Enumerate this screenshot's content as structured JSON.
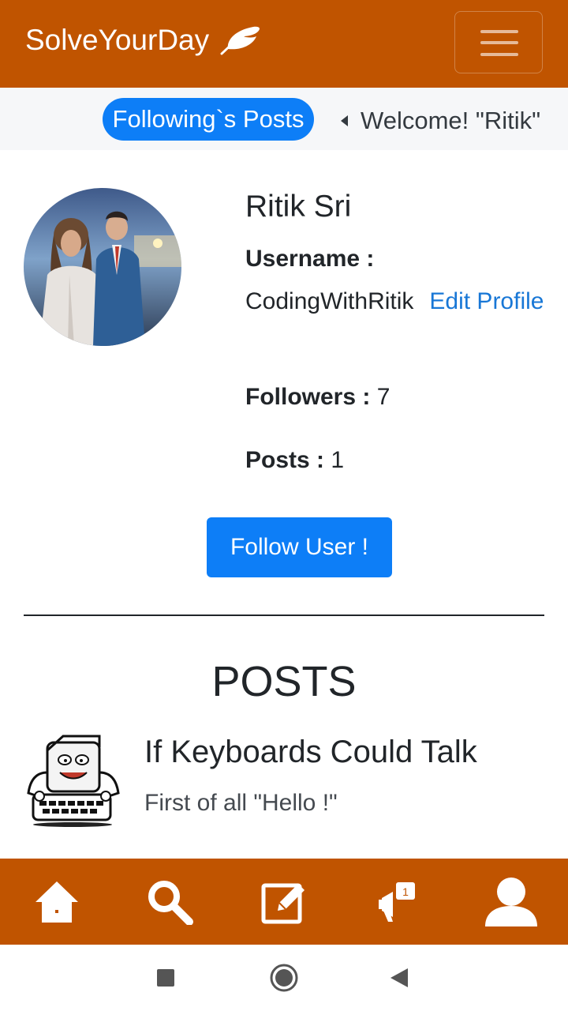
{
  "navbar": {
    "brand": "SolveYourDay",
    "brand_icon": "feather-icon",
    "menu_icon": "hamburger-icon"
  },
  "subbar": {
    "following_posts": "Following`s Posts",
    "welcome": "Welcome! \"Ritik\""
  },
  "profile": {
    "name": "Ritik Sri",
    "username_label": "Username :",
    "username": "CodingWithRitik",
    "edit_profile": "Edit Profile",
    "followers_label": "Followers :",
    "followers_count": "7",
    "posts_label": "Posts :",
    "posts_count": "1",
    "follow_button": "Follow User !"
  },
  "posts": {
    "heading": "POSTS",
    "items": [
      {
        "title": "If Keyboards Could Talk",
        "excerpt": "First of all \"Hello !\""
      }
    ]
  },
  "bottom_nav": {
    "items": [
      "home-icon",
      "search-icon",
      "edit-icon",
      "notification-icon",
      "user-icon"
    ],
    "notification_badge": "1"
  },
  "system_nav": [
    "recent-apps-icon",
    "home-circle-icon",
    "back-icon"
  ],
  "colors": {
    "brand": "#c05400",
    "primary": "#0d7ef7",
    "link": "#1877d6"
  }
}
